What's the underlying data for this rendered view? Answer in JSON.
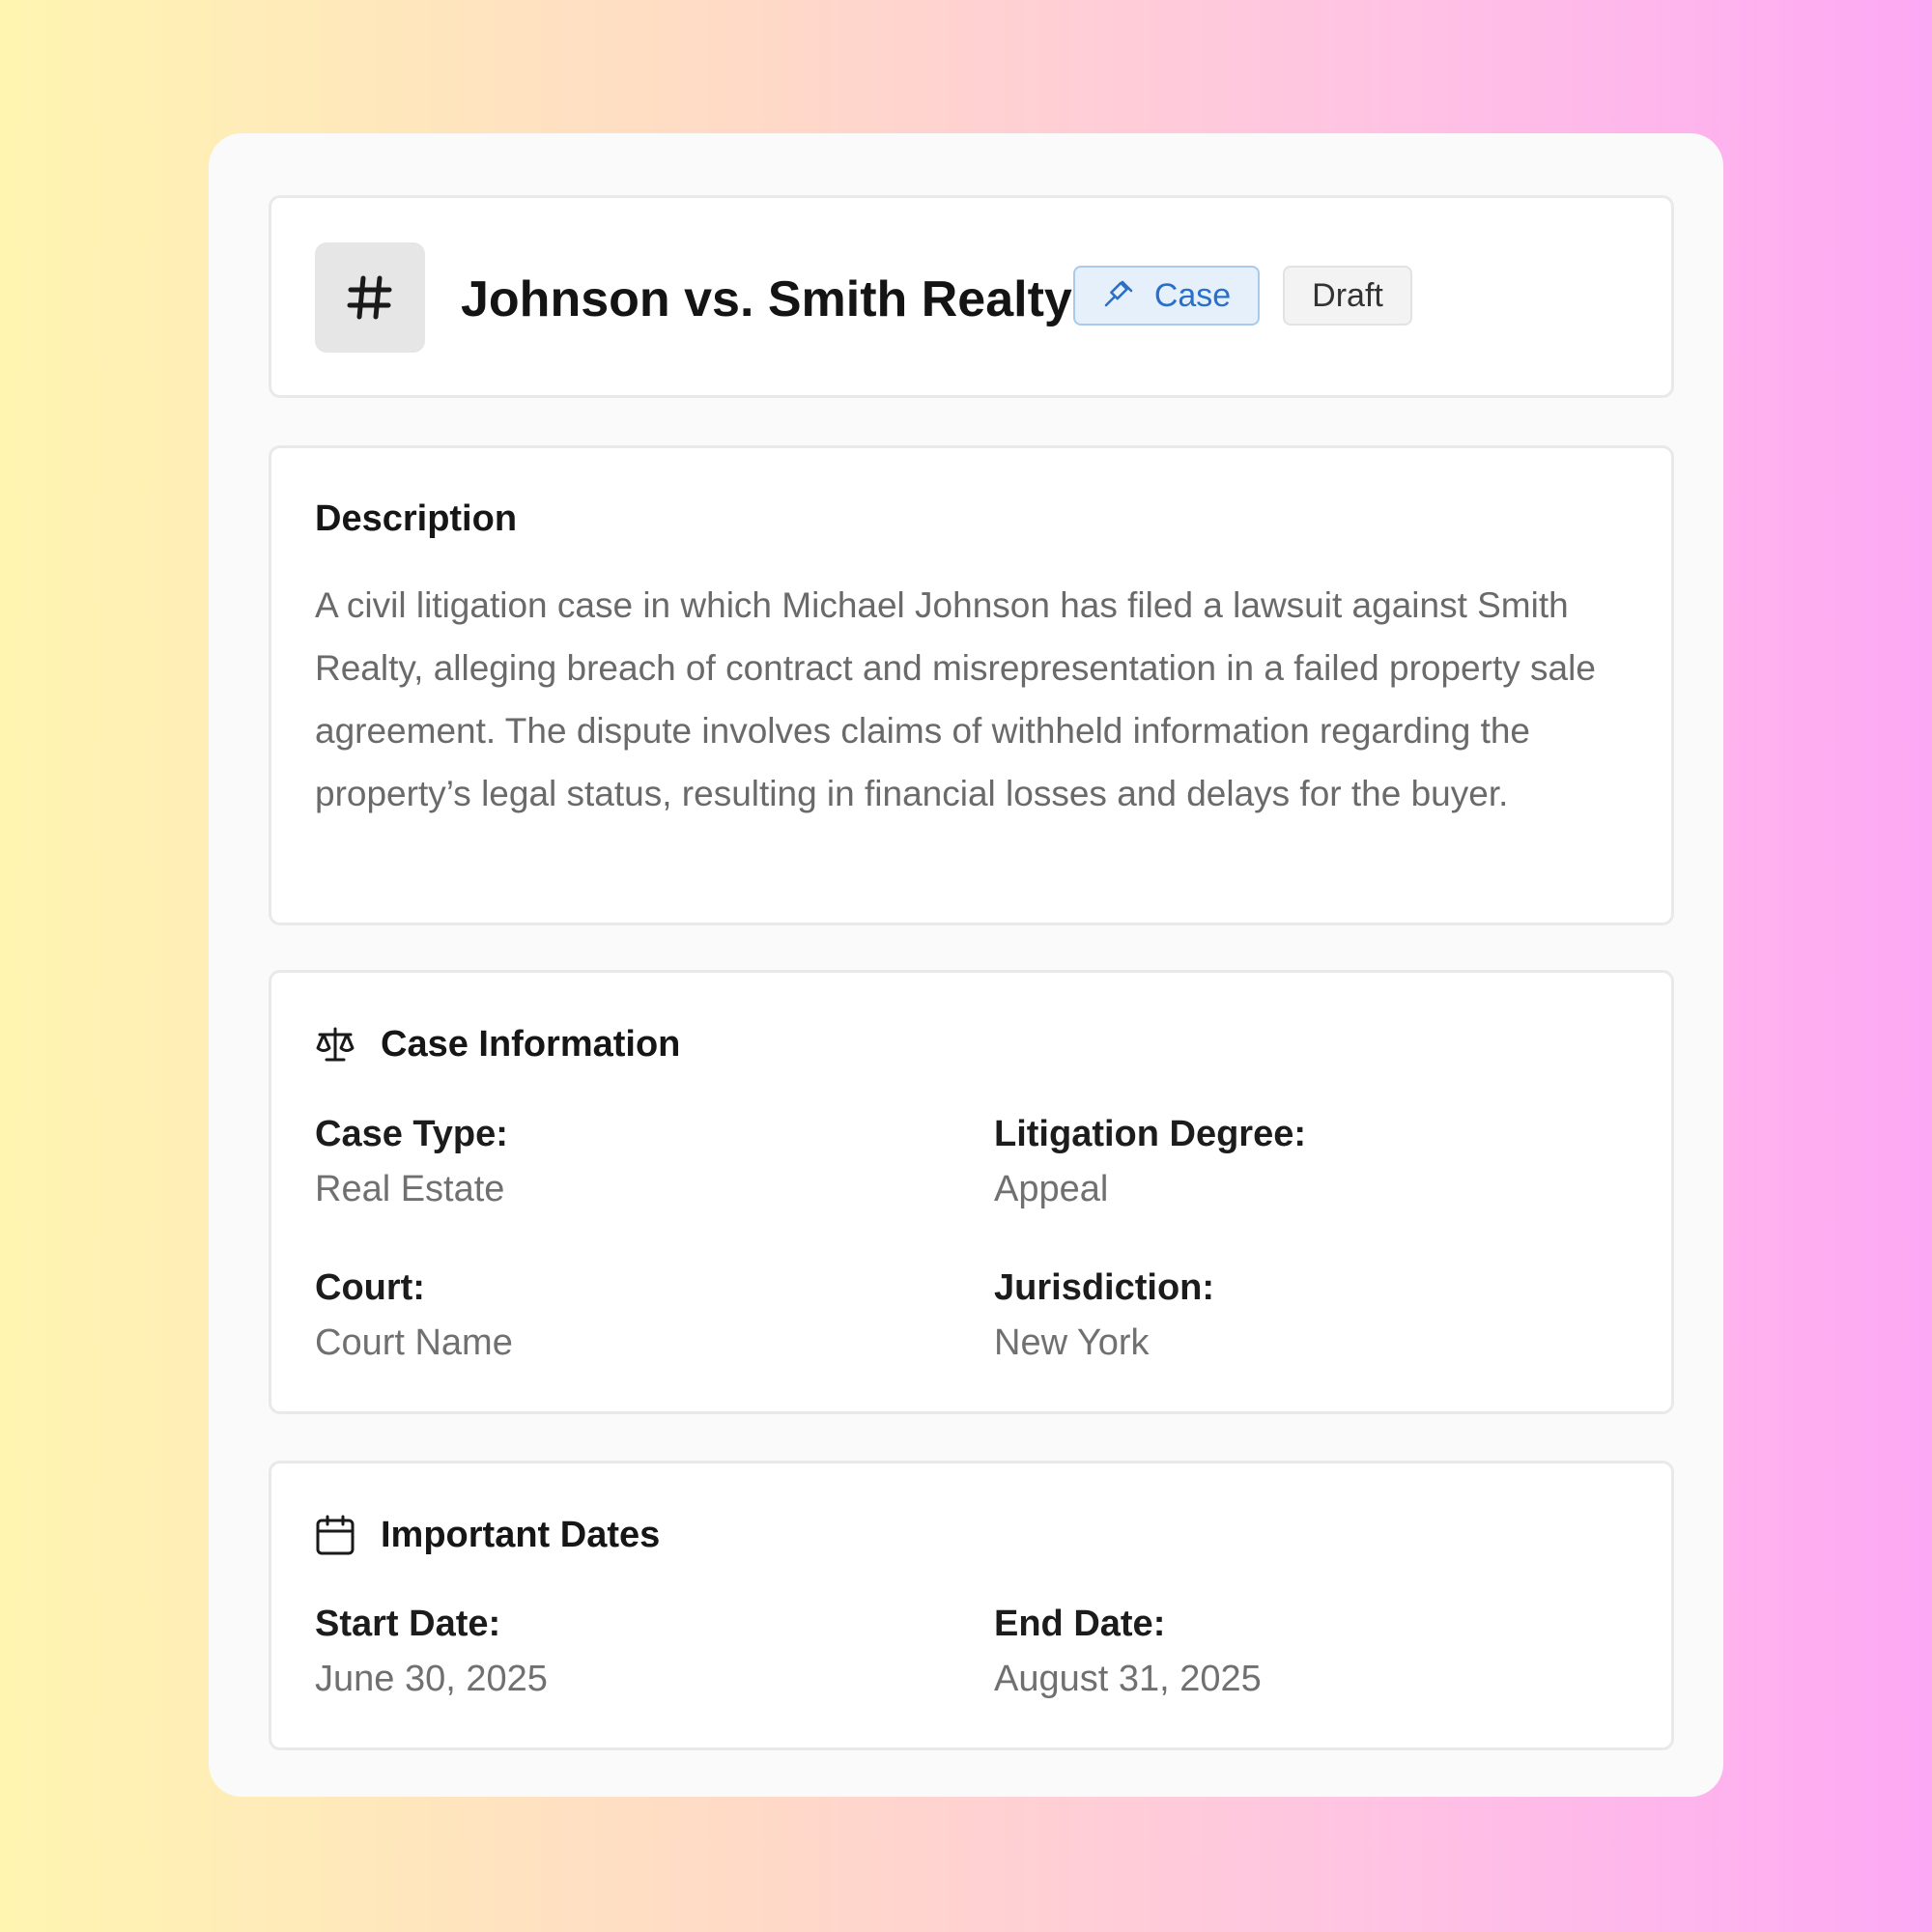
{
  "header": {
    "icon": "hash-icon",
    "title": "Johnson vs. Smith Realty",
    "case_badge": {
      "label": "Case",
      "icon": "gavel-icon",
      "color": "#2a6fc9"
    },
    "status_badge": "Draft"
  },
  "description": {
    "title": "Description",
    "text": "A civil litigation case in which Michael Johnson has filed a lawsuit against Smith Realty, alleging breach of contract and misrepresentation in a failed property sale agreement. The dispute involves claims of withheld information regarding the property’s legal status, resulting in financial losses and delays for the buyer."
  },
  "case_info": {
    "icon": "scale-icon",
    "title": "Case Information",
    "fields": [
      {
        "label": "Case Type:",
        "value": "Real Estate"
      },
      {
        "label": "Litigation Degree:",
        "value": "Appeal"
      },
      {
        "label": "Court:",
        "value": "Court Name"
      },
      {
        "label": "Jurisdiction:",
        "value": "New York"
      }
    ]
  },
  "dates": {
    "icon": "calendar-icon",
    "title": "Important Dates",
    "fields": [
      {
        "label": "Start Date:",
        "value": "June 30, 2025"
      },
      {
        "label": "End Date:",
        "value": "August 31, 2025"
      }
    ]
  }
}
